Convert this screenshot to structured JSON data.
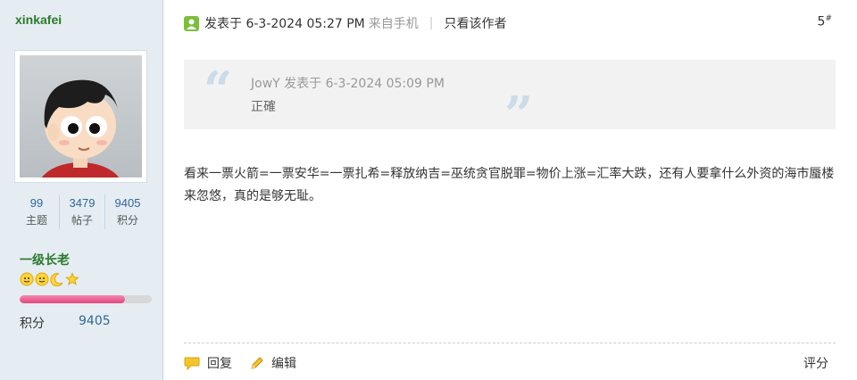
{
  "user": {
    "name": "xinkafei",
    "stats": [
      {
        "value": "99",
        "label": "主题"
      },
      {
        "value": "3479",
        "label": "帖子"
      },
      {
        "value": "9405",
        "label": "积分"
      }
    ],
    "rank": "一级长老",
    "level_progress": 0.8,
    "credit_label": "积分",
    "credit_value": "9405"
  },
  "post": {
    "posted_at": "发表于 6-3-2024 05:27 PM",
    "source": "来自手机",
    "separator": "|",
    "only_author": "只看该作者",
    "floor_number": "5",
    "floor_mark": "#",
    "quote": {
      "author_line": "JowY 发表于 6-3-2024 05:09 PM",
      "text": "正確"
    },
    "body": "看来一票火箭=一票安华=一票扎希=释放纳吉=巫统贪官脱罪=物价上涨=汇率大跌，还有人要拿什么外资的海市蜃楼来忽悠，真的是够无耻。"
  },
  "footer": {
    "reply": "回复",
    "edit": "编辑",
    "rate": "评分"
  },
  "colors": {
    "sidebar_bg": "#e5edf2",
    "username": "#2a7a2a",
    "link_blue": "#336699",
    "quote_bg": "#f2f2f2"
  }
}
